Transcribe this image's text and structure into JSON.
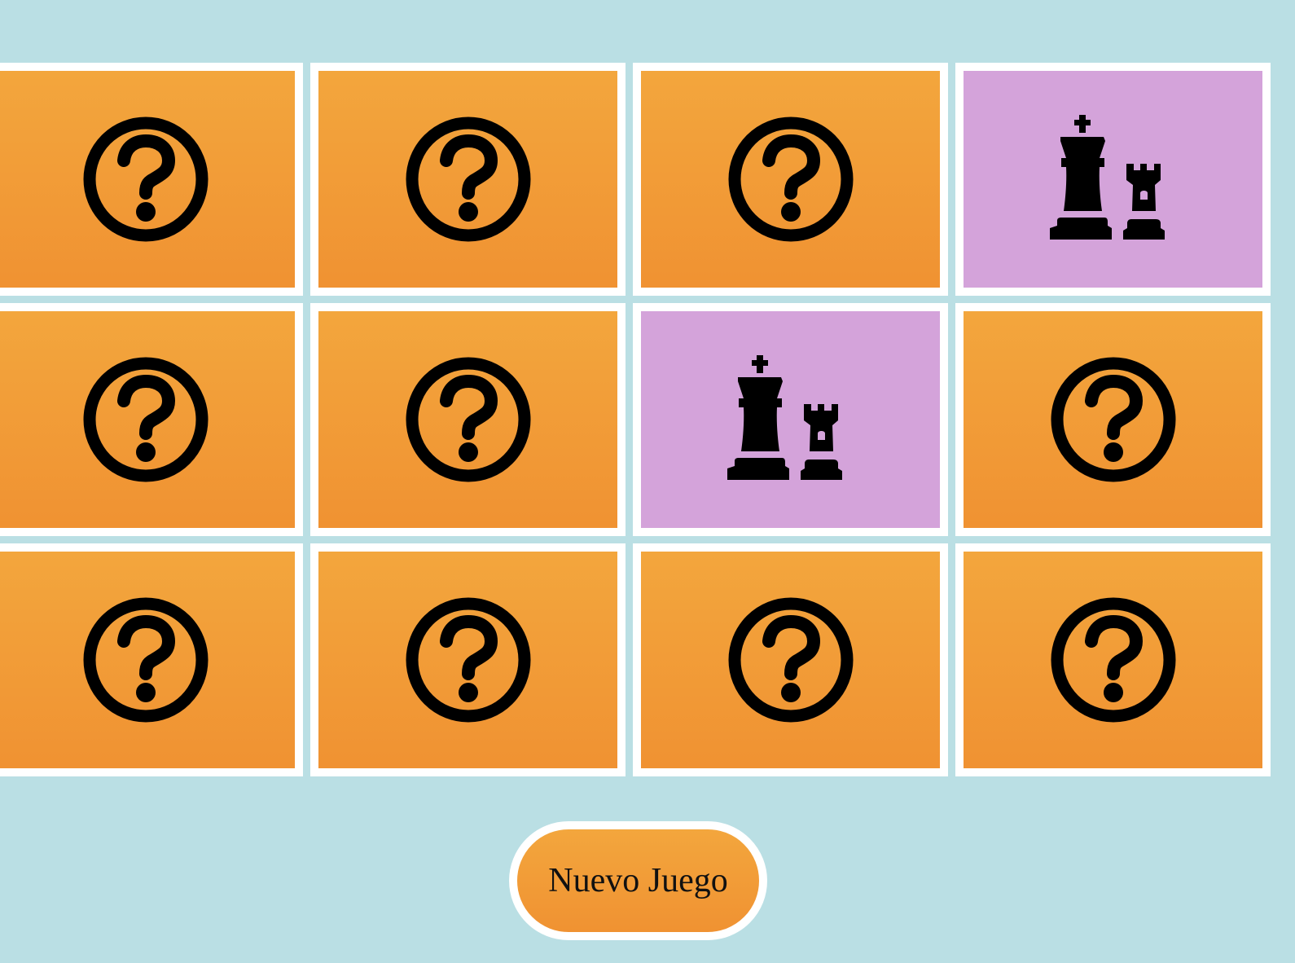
{
  "colors": {
    "background": "#badfe4",
    "card_hidden": "#f09232",
    "card_revealed": "#d4a3da",
    "card_border": "#ffffff",
    "icon": "#000000"
  },
  "board": {
    "rows": 3,
    "columns": 4,
    "cards": [
      {
        "state": "hidden",
        "icon": "question-circle-icon"
      },
      {
        "state": "hidden",
        "icon": "question-circle-icon"
      },
      {
        "state": "hidden",
        "icon": "question-circle-icon"
      },
      {
        "state": "revealed",
        "icon": "chess-king-rook-icon"
      },
      {
        "state": "hidden",
        "icon": "question-circle-icon"
      },
      {
        "state": "hidden",
        "icon": "question-circle-icon"
      },
      {
        "state": "revealed",
        "icon": "chess-king-rook-icon"
      },
      {
        "state": "hidden",
        "icon": "question-circle-icon"
      },
      {
        "state": "hidden",
        "icon": "question-circle-icon"
      },
      {
        "state": "hidden",
        "icon": "question-circle-icon"
      },
      {
        "state": "hidden",
        "icon": "question-circle-icon"
      },
      {
        "state": "hidden",
        "icon": "question-circle-icon"
      }
    ]
  },
  "controls": {
    "new_game_label": "Nuevo Juego"
  }
}
